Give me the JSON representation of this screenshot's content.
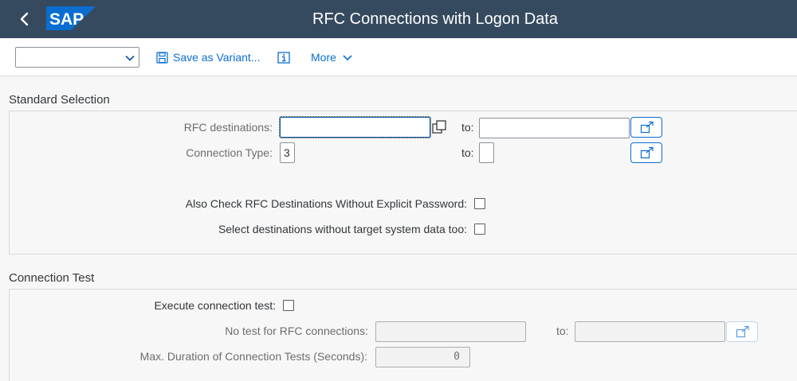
{
  "shell": {
    "title": "RFC Connections with Logon Data",
    "logo_text": "SAP",
    "logo_color": "#0a6ed1",
    "background_color": "#354a5f"
  },
  "toolbar": {
    "variant_value": "",
    "save_variant_label": "Save as Variant...",
    "info_icon": "info-icon",
    "more_label": "More"
  },
  "standard_selection": {
    "title": "Standard Selection",
    "rfc_destinations": {
      "label": "RFC destinations:",
      "from_value": "",
      "to_label": "to:",
      "to_value": ""
    },
    "connection_type": {
      "label": "Connection Type:",
      "from_value": "3",
      "to_label": "to:",
      "to_value": ""
    },
    "check_without_password": {
      "label": "Also Check RFC Destinations Without Explicit Password:",
      "checked": false
    },
    "without_target_system": {
      "label": "Select destinations without target system data too:",
      "checked": false
    }
  },
  "connection_test": {
    "title": "Connection Test",
    "execute_test": {
      "label": "Execute connection test:",
      "checked": false
    },
    "no_test_rfc": {
      "label": "No test for RFC connections:",
      "from_value": "",
      "to_label": "to:",
      "to_value": ""
    },
    "max_duration": {
      "label": "Max. Duration of Connection Tests (Seconds):",
      "value": "0"
    }
  }
}
